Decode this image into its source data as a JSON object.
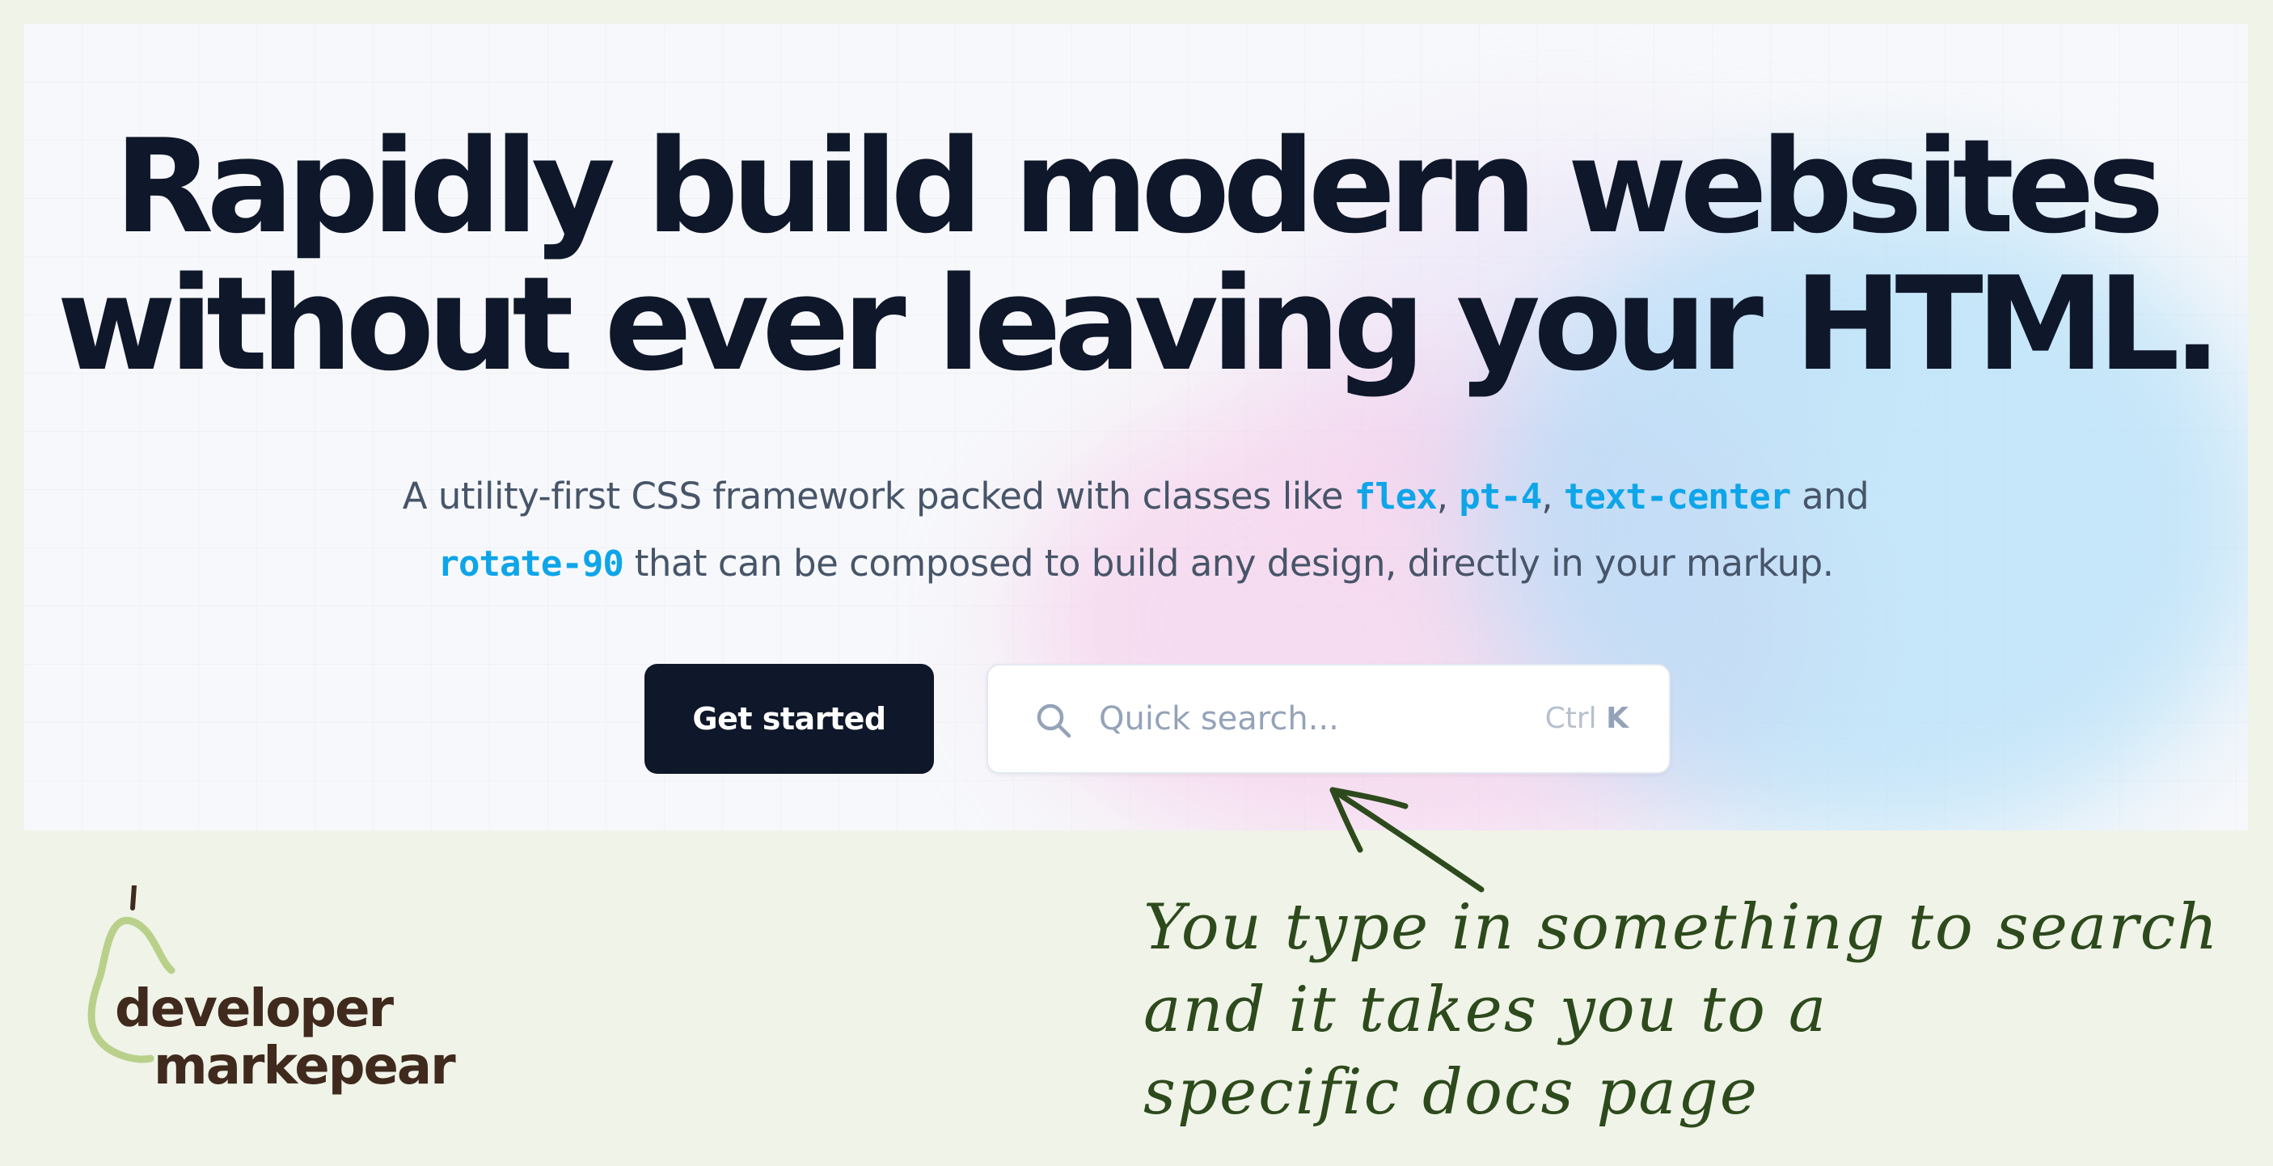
{
  "hero": {
    "headline_line1": "Rapidly build modern websites",
    "headline_line2": "without ever leaving your HTML.",
    "subtext": {
      "part1": "A utility-first CSS framework packed with classes like ",
      "code1": "flex",
      "sep1": ", ",
      "code2": "pt-4",
      "sep2": ", ",
      "code3": "text-center",
      "part2": " and",
      "code4": "rotate-90",
      "part3": " that can be composed to build any design, directly in your markup."
    },
    "get_started_label": "Get started",
    "search": {
      "placeholder": "Quick search...",
      "shortcut_modifier": "Ctrl",
      "shortcut_key": "K"
    }
  },
  "annotation": {
    "line1": "You type in something to search",
    "line2": "and it takes you to a",
    "line3": "specific docs page"
  },
  "logo": {
    "line1": "developer",
    "line2": "markepear"
  },
  "colors": {
    "page_background": "#f0f3e8",
    "headline": "#0f172a",
    "body_text": "#475569",
    "code_accent": "#0ea5e9",
    "button_background": "#0f172a",
    "annotation_ink": "#2d4a1c",
    "logo_text": "#3f2a1d",
    "logo_pear": "#b9d08a"
  },
  "icons": {
    "search": "search-icon",
    "arrow": "arrow-icon",
    "logo": "pear-icon"
  }
}
